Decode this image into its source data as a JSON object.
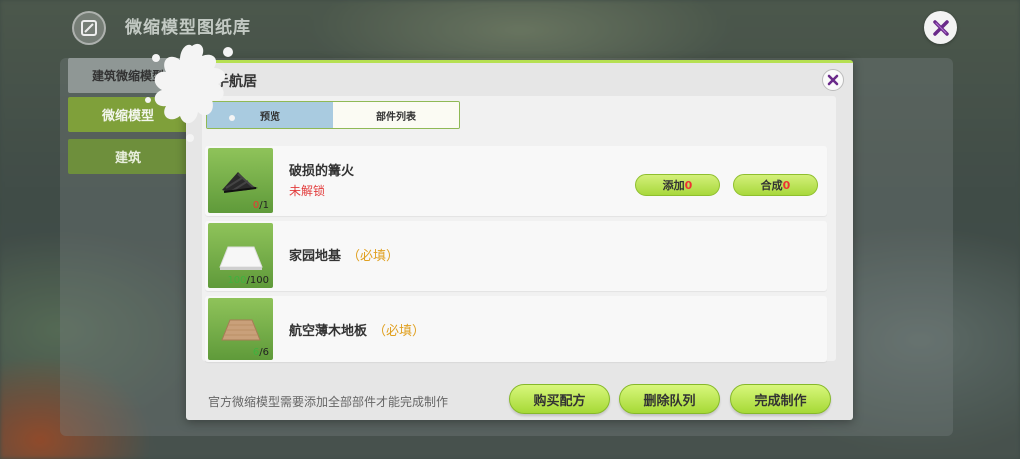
{
  "library": {
    "title": "微缩模型图纸库",
    "side_tabs": [
      "建筑微缩模型",
      "微缩模型",
      "建筑"
    ]
  },
  "dialog": {
    "title": "新手航居",
    "tabs": {
      "preview": "预览",
      "parts": "部件列表"
    },
    "items": [
      {
        "name": "破损的篝火",
        "status": "未解锁",
        "have": "0",
        "need": "/1",
        "add_label": "添加",
        "add_count": "0",
        "craft_label": "合成",
        "craft_count": "0"
      },
      {
        "name": "家园地基",
        "required": "（必填）",
        "have": "100",
        "need": "/100"
      },
      {
        "name": "航空薄木地板",
        "required": "（必填）",
        "have": "6",
        "need": "/6"
      }
    ],
    "footer_note": "官方微缩模型需要添加全部部件才能完成制作",
    "buttons": {
      "buy": "购买配方",
      "delete_queue": "删除队列",
      "finish": "完成制作"
    }
  },
  "colors": {
    "accent_green": "#a8d83c",
    "warning_red": "#e23b3b",
    "required_orange": "#e0a020",
    "close_purple": "#6a2a8a"
  }
}
